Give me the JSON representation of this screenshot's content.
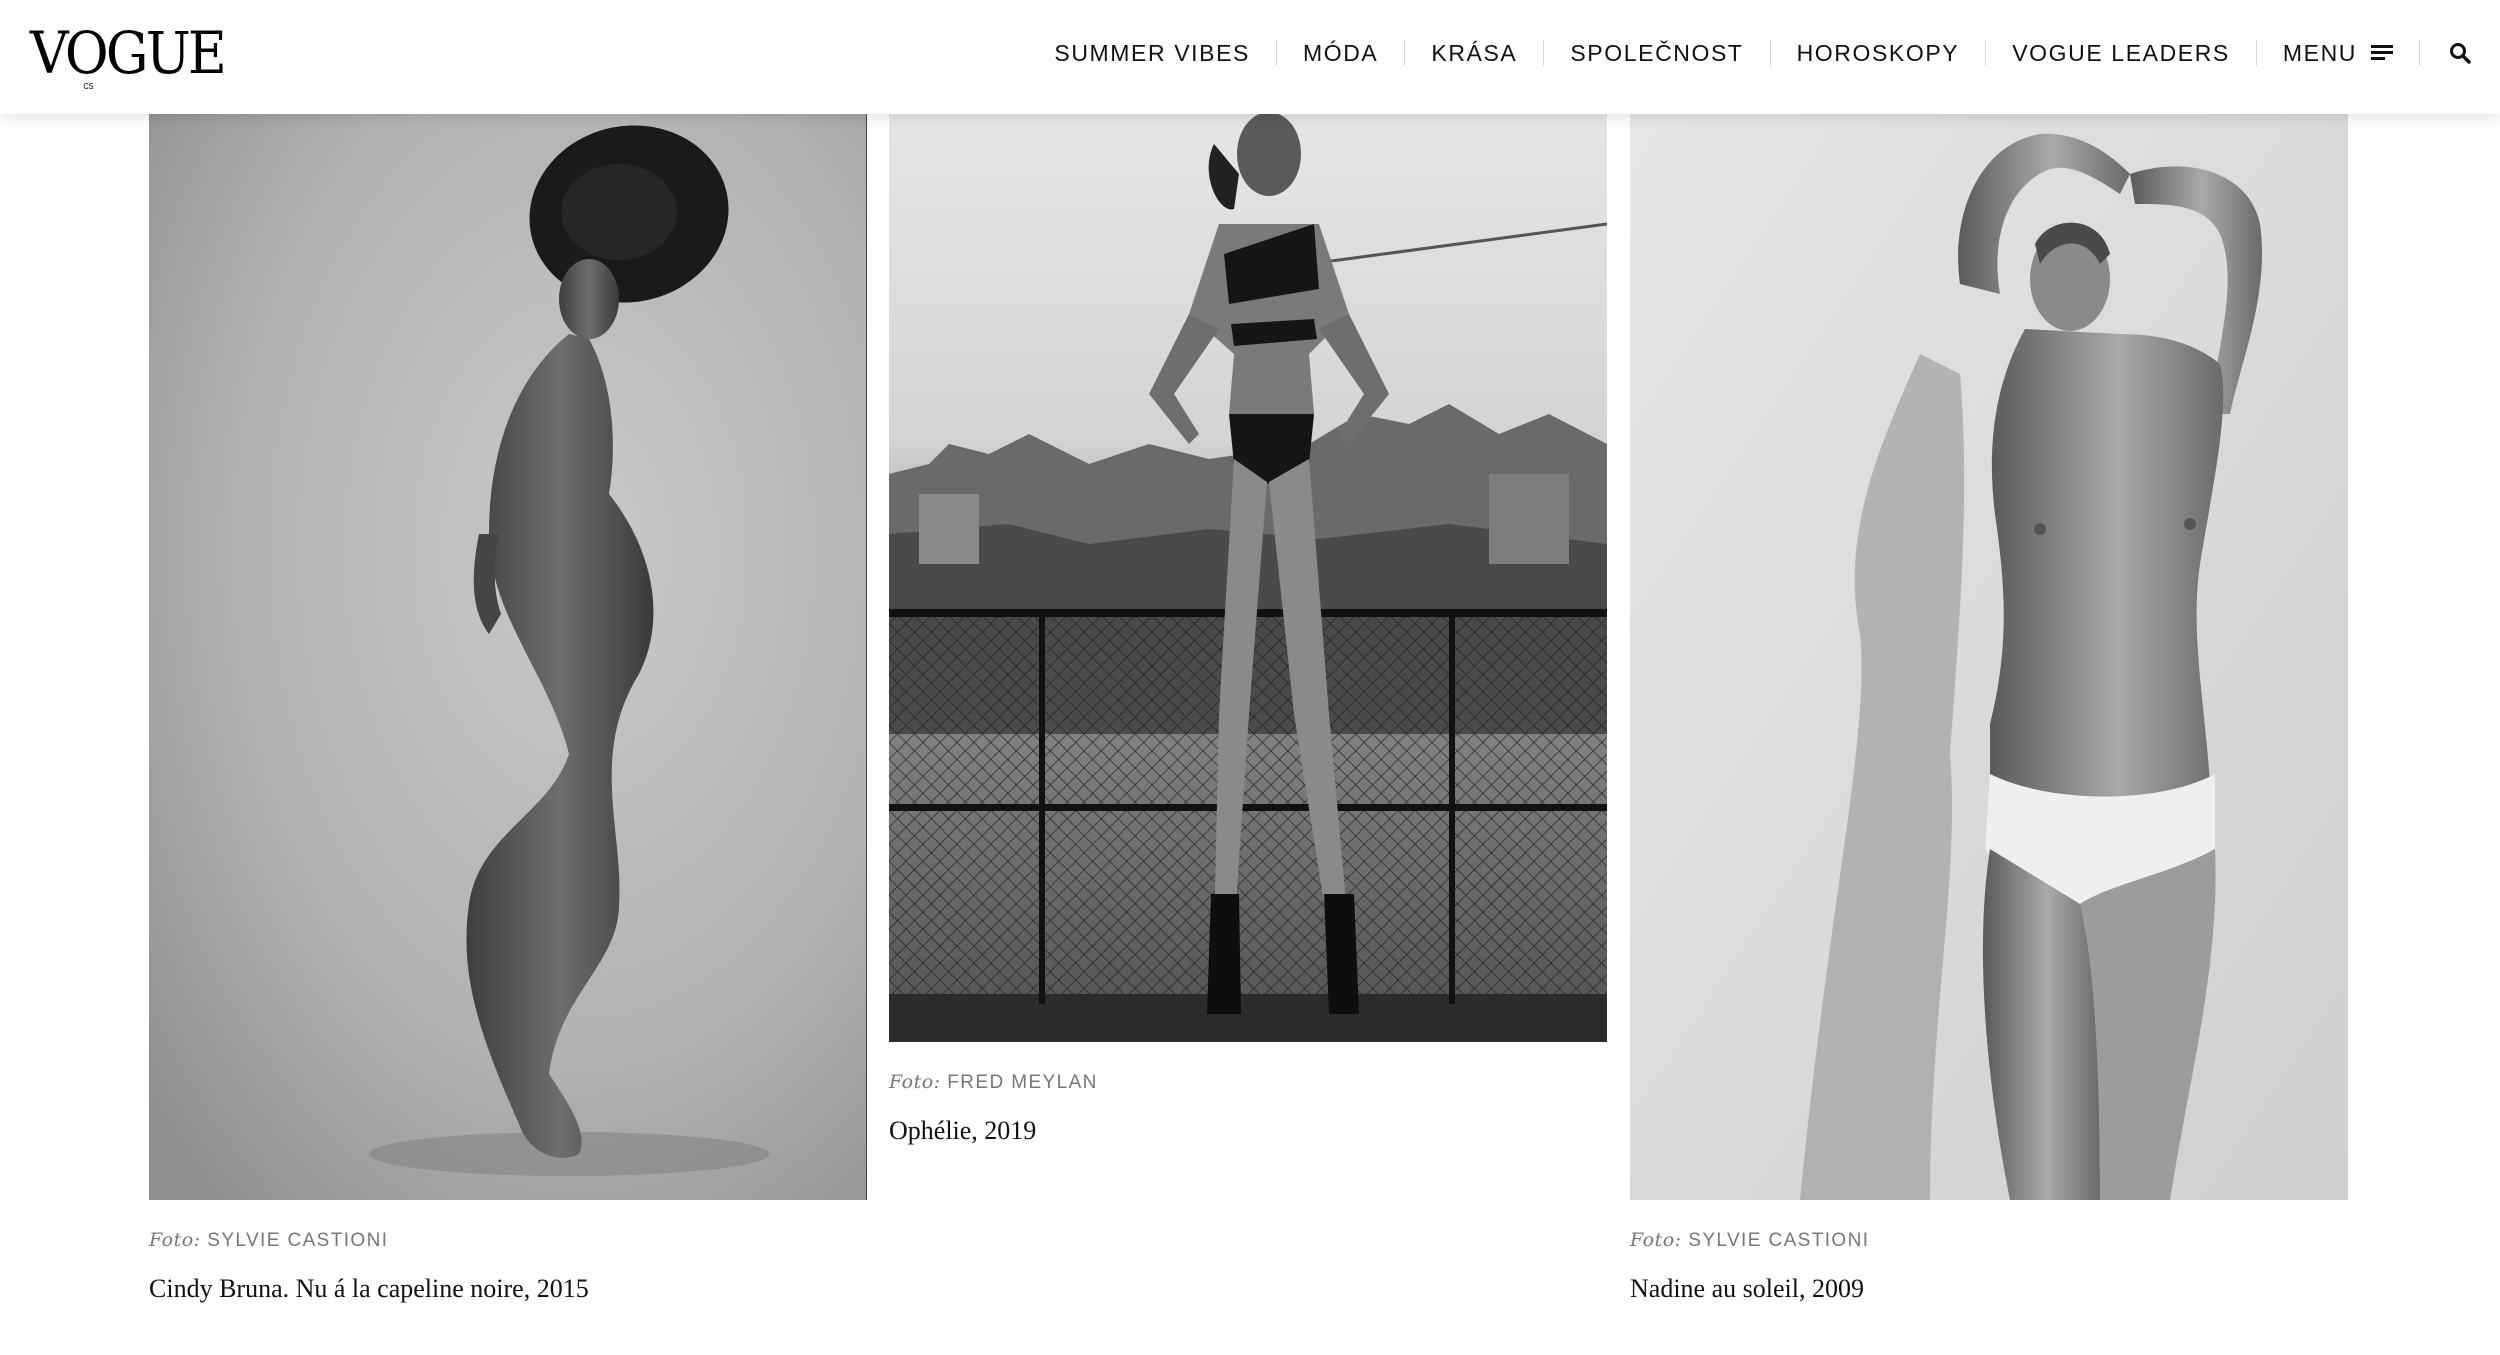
{
  "header": {
    "logo": "VOGUE",
    "logo_edition": "CS",
    "nav": [
      "SUMMER VIBES",
      "MÓDA",
      "KRÁSA",
      "SPOLEČNOST",
      "HOROSKOPY",
      "VOGUE LEADERS"
    ],
    "menu_label": "MENU",
    "icons": {
      "menu": "hamburger-icon",
      "search": "search-icon"
    }
  },
  "gallery": [
    {
      "credit_prefix": "Foto:",
      "photographer": "SYLVIE CASTIONI",
      "caption": "Cindy Bruna. Nu á la capeline noire, 2015"
    },
    {
      "credit_prefix": "Foto:",
      "photographer": "FRED MEYLAN",
      "caption": "Ophélie, 2019"
    },
    {
      "credit_prefix": "Foto:",
      "photographer": "SYLVIE CASTIONI",
      "caption": "Nadine au soleil, 2009"
    }
  ]
}
